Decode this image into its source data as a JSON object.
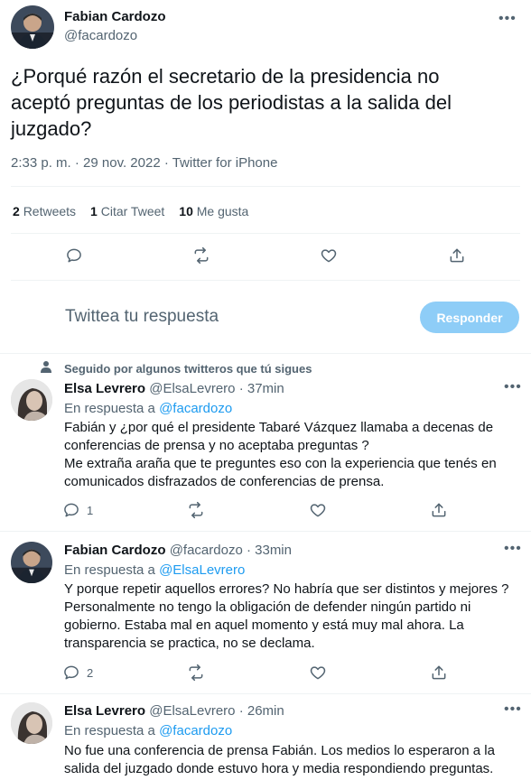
{
  "main_tweet": {
    "author_name": "Fabian Cardozo",
    "author_handle": "@facardozo",
    "text": "¿Porqué razón el secretario de la presidencia no aceptó preguntas de los periodistas a la salida del juzgado?",
    "timestamp": "2:33 p. m. · 29 nov. 2022 · Twitter for iPhone",
    "stats": {
      "retweets_count": "2",
      "retweets_label": "Retweets",
      "quotes_count": "1",
      "quotes_label": "Citar Tweet",
      "likes_count": "10",
      "likes_label": "Me gusta"
    },
    "actions": [
      "reply-icon",
      "retweet-icon",
      "like-icon",
      "share-icon"
    ]
  },
  "composer": {
    "placeholder": "Twittea tu respuesta",
    "button_label": "Responder",
    "button_color": "#8ecdf7"
  },
  "social_context": "Seguido por algunos twitteros que tú sigues",
  "replies": [
    {
      "name": "Elsa Levrero",
      "handle": "@ElsaLevrero",
      "time": "· 37min",
      "in_reply_prefix": "En respuesta a",
      "in_reply_to": "@facardozo",
      "paragraphs": [
        "Fabián y ¿por qué el presidente Tabaré Vázquez llamaba a decenas de conferencias de prensa y no aceptaba preguntas ?",
        "Me extraña araña que te preguntes eso con la experiencia que tenés en comunicados disfrazados de conferencias de prensa."
      ],
      "reply_count": "1",
      "more": "•••"
    },
    {
      "name": "Fabian Cardozo",
      "handle": "@facardozo",
      "time": "· 33min",
      "in_reply_prefix": "En respuesta a",
      "in_reply_to": "@ElsaLevrero",
      "paragraphs": [
        "Y porque repetir aquellos errores? No habría que ser distintos y mejores ? Personalmente no tengo la obligación de defender ningún partido ni gobierno. Estaba mal en aquel momento y está muy mal ahora. La transparencia se practica, no se declama."
      ],
      "reply_count": "2",
      "more": "•••"
    },
    {
      "name": "Elsa Levrero",
      "handle": "@ElsaLevrero",
      "time": "· 26min",
      "in_reply_prefix": "En respuesta a",
      "in_reply_to": "@facardozo",
      "paragraphs": [
        "No fue una conferencia de prensa Fabián. Los medios lo esperaron a la salida del juzgado donde estuvo hora y media respondiendo preguntas."
      ],
      "reply_count": "",
      "more": "•••"
    }
  ],
  "colors": {
    "accent": "#1d9bf0",
    "muted": "#536471",
    "text": "#0f1419"
  }
}
